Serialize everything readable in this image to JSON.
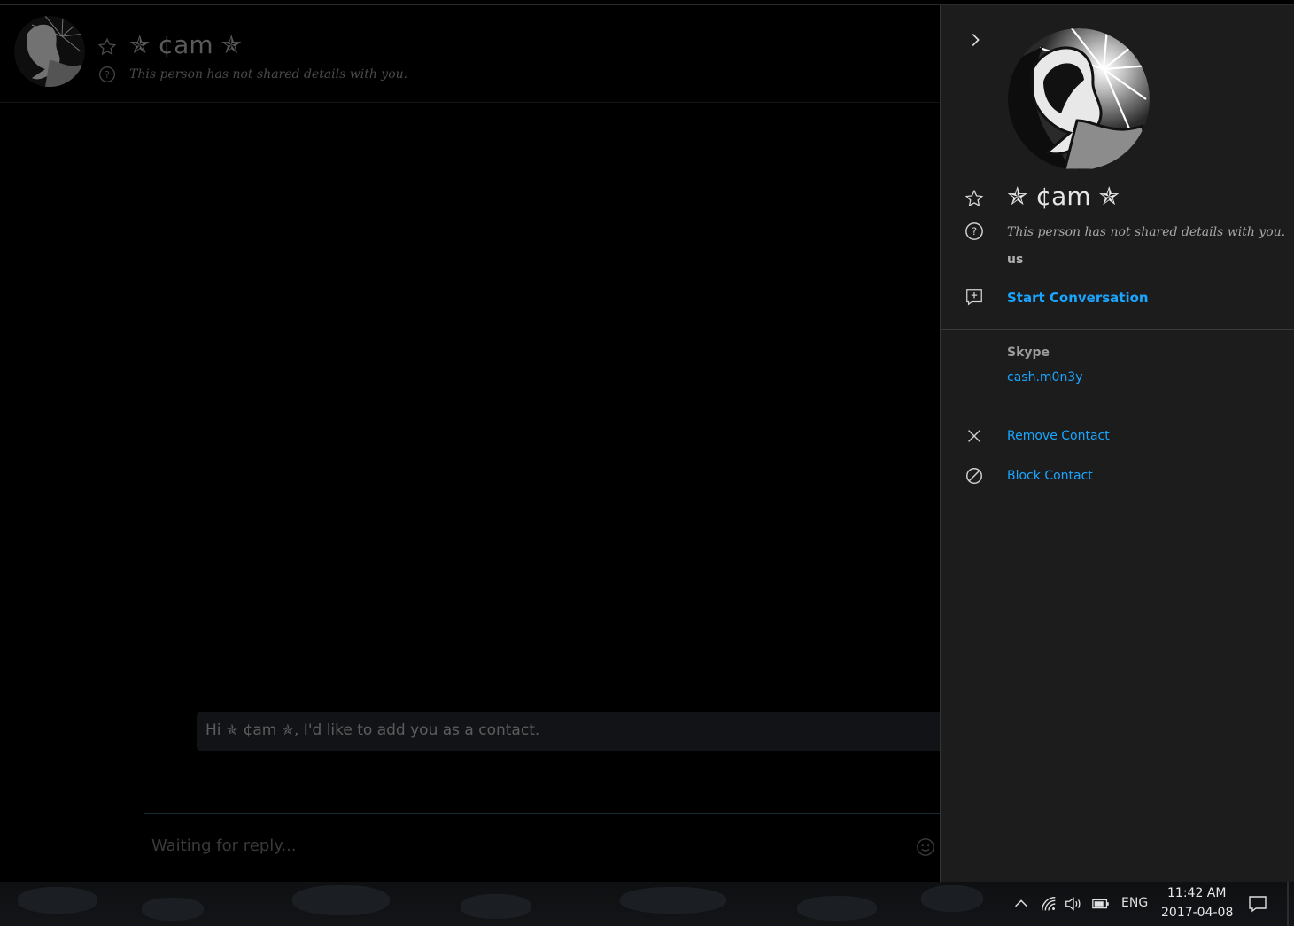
{
  "contact": {
    "name": "✯ ¢am ✯",
    "status": "This person has not shared details with you.",
    "location": "us",
    "start_conversation": "Start Conversation",
    "account_label": "Skype",
    "account_id": "cash.m0n3y",
    "remove": "Remove Contact",
    "block": "Block Contact"
  },
  "chat": {
    "message": "Hi ✯ ¢am ✯, I'd like to add you as a contact.",
    "composer_placeholder": "Waiting for reply..."
  },
  "taskbar": {
    "language": "ENG",
    "time": "11:42 AM",
    "date": "2017-04-08"
  },
  "icons": {
    "collapse": "chevron-right-icon",
    "favorite": "star-outline-icon",
    "help": "question-circle-icon",
    "start_conversation": "chat-add-icon",
    "remove": "close-icon",
    "block": "block-icon",
    "emoji": "smiley-icon",
    "tray": [
      "chevron-up-icon",
      "wifi-icon",
      "volume-icon",
      "battery-icon"
    ],
    "action_center": "notification-icon"
  },
  "colors": {
    "link": "#1aa6ff",
    "panel_bg": "#1c1c1c",
    "chat_bg": "#000000"
  }
}
